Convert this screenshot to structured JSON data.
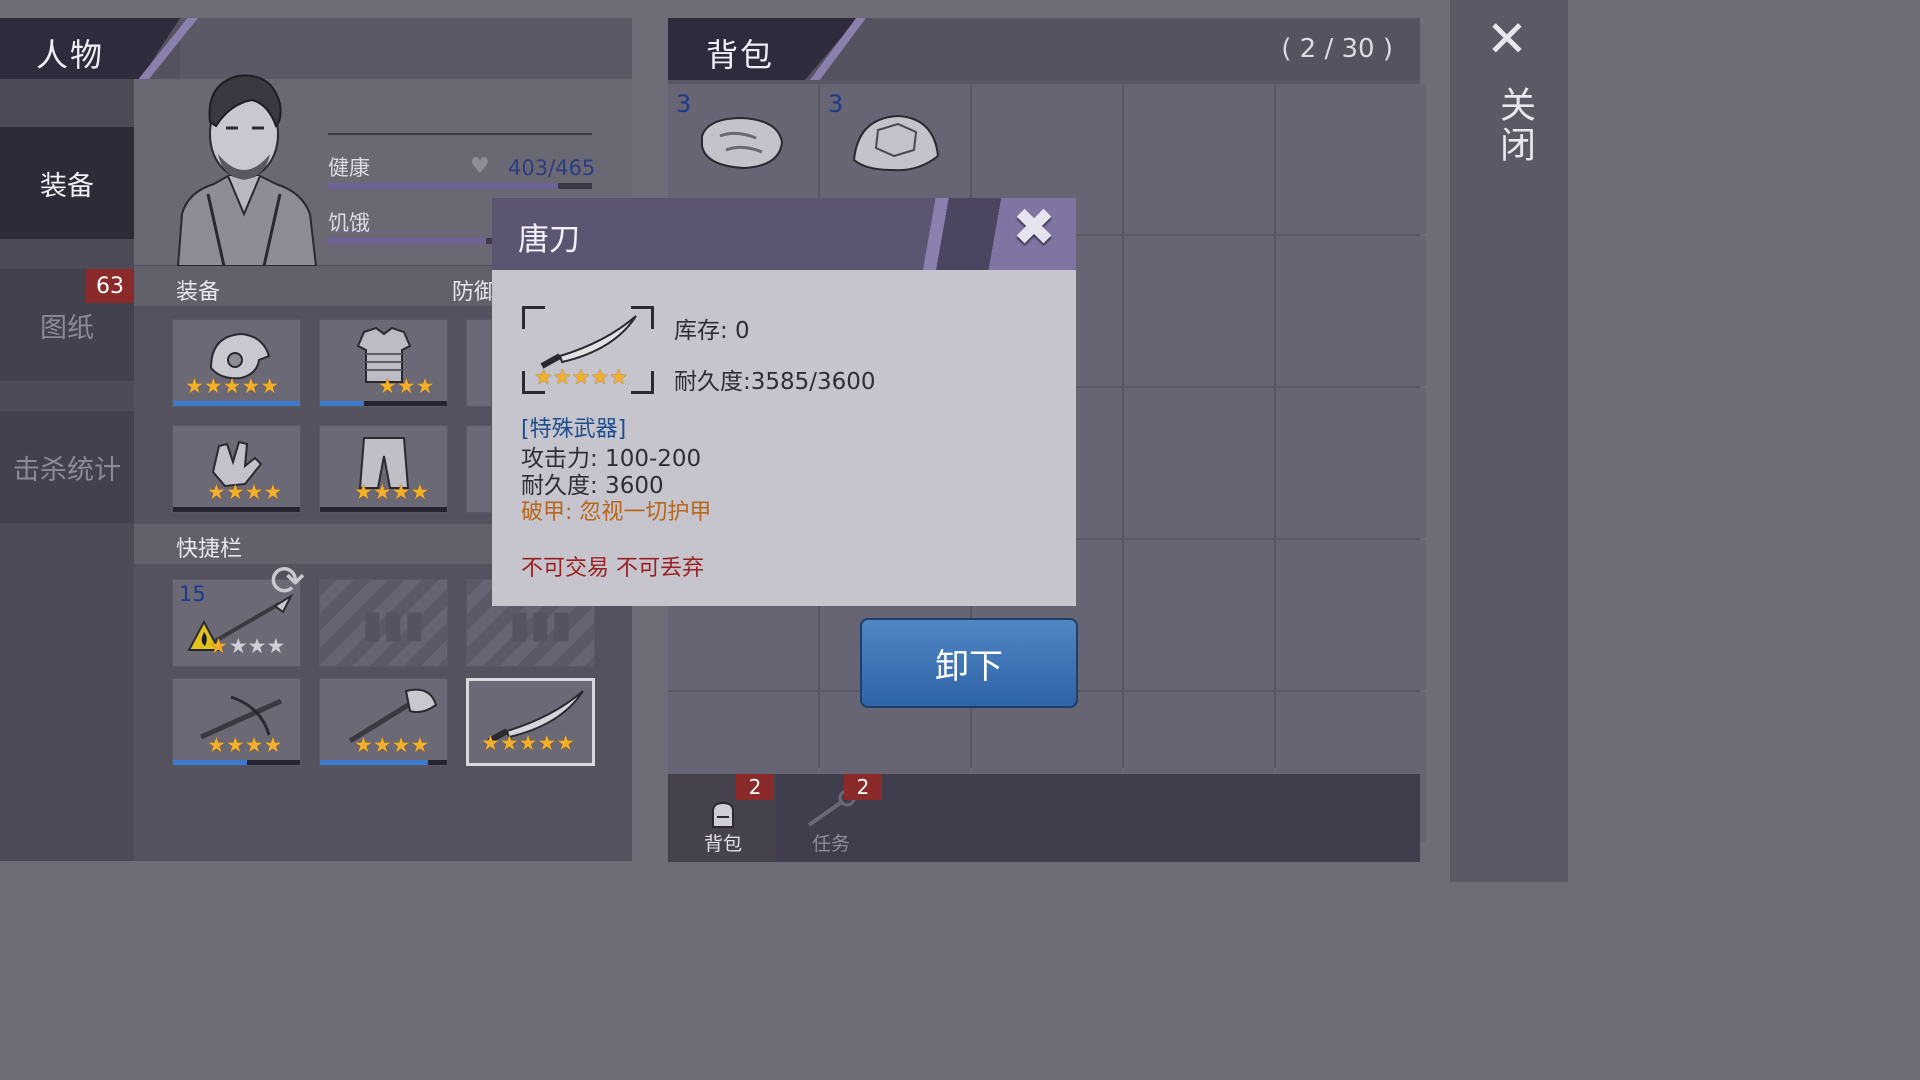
{
  "character": {
    "title": "人物",
    "tabs": [
      {
        "label": "装备"
      },
      {
        "label": "图纸",
        "badge": "63"
      },
      {
        "label": "击杀统计"
      }
    ],
    "stats": {
      "health_label": "健康",
      "health_value": "403/465",
      "health_fraction": 0.87,
      "hunger_label": "饥饿",
      "hunger_fraction": 0.6
    },
    "equipment_label": "装备",
    "defense_label": "防御",
    "quickbar_label": "快捷栏",
    "quickbar_count": "15"
  },
  "bag": {
    "title": "背包",
    "count": "( 2 / 30 )",
    "items": [
      {
        "count": "3",
        "name": "meat"
      },
      {
        "count": "3",
        "name": "turtle-shell"
      }
    ],
    "bottom_tabs": [
      {
        "label": "背包",
        "badge": "2"
      },
      {
        "label": "任务",
        "badge": "2"
      }
    ]
  },
  "close_label": "关闭",
  "popup": {
    "title": "唐刀",
    "stock": "库存: 0",
    "durability_current": "耐久度:3585/3600",
    "category": "[特殊武器]",
    "attack": "攻击力: 100-200",
    "durability": "耐久度: 3600",
    "armor_pierce": "破甲: 忽视一切护甲",
    "restrictions": "不可交易 不可丢弃",
    "stars": 5
  },
  "unequip_button": "卸下",
  "colors": {
    "accent": "#8b7fae",
    "star": "#f3b02b",
    "badge": "#8a2a2a",
    "button": "#3a72b8"
  }
}
